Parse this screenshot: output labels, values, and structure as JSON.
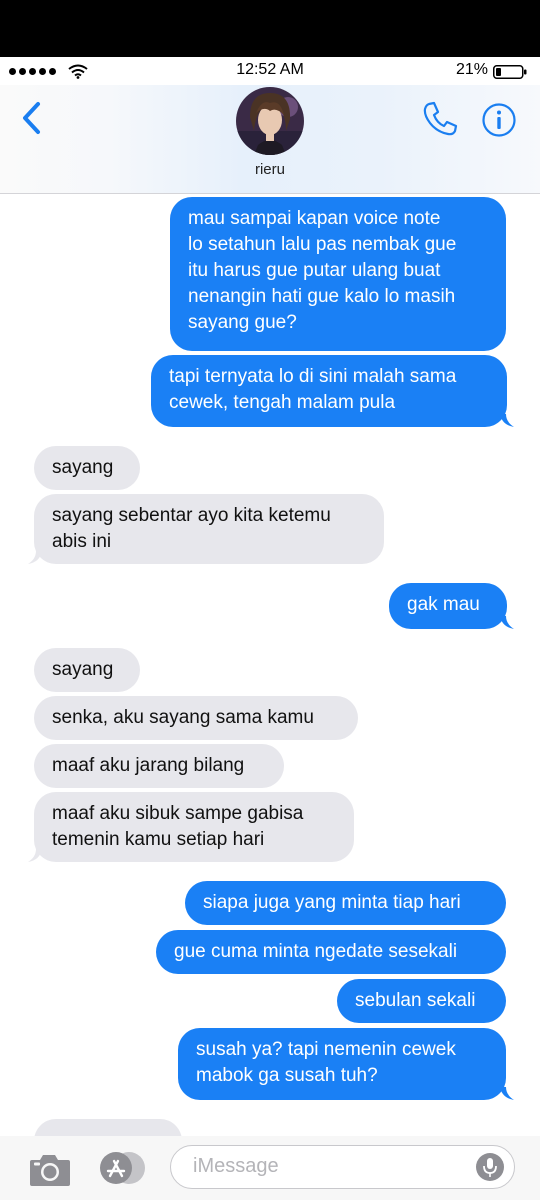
{
  "status_bar": {
    "time": "12:52 AM",
    "battery": "21%"
  },
  "header": {
    "contact_name": "rieru"
  },
  "messages": [
    {
      "from": "me",
      "lines": [
        "mau sampai kapan voice note",
        "lo setahun lalu pas nembak gue",
        "itu harus gue putar ulang buat",
        "nenangin hati gue kalo lo masih",
        "sayang gue?"
      ]
    },
    {
      "from": "me",
      "lines": [
        "tapi ternyata lo di sini malah sama",
        "cewek, tengah malam pula"
      ]
    },
    {
      "from": "them",
      "lines": [
        "sayang"
      ]
    },
    {
      "from": "them",
      "lines": [
        "sayang sebentar ayo kita ketemu",
        "abis ini"
      ]
    },
    {
      "from": "me",
      "lines": [
        "gak mau"
      ]
    },
    {
      "from": "them",
      "lines": [
        "sayang"
      ]
    },
    {
      "from": "them",
      "lines": [
        "senka, aku sayang sama kamu"
      ]
    },
    {
      "from": "them",
      "lines": [
        "maaf aku jarang bilang"
      ]
    },
    {
      "from": "them",
      "lines": [
        "maaf aku sibuk sampe gabisa",
        "temenin kamu setiap hari"
      ]
    },
    {
      "from": "me",
      "lines": [
        "siapa juga yang minta tiap hari"
      ]
    },
    {
      "from": "me",
      "lines": [
        "gue cuma minta ngedate sesekali"
      ]
    },
    {
      "from": "me",
      "lines": [
        "sebulan sekali"
      ]
    },
    {
      "from": "me",
      "lines": [
        "susah ya? tapi nemenin cewek",
        "mabok ga susah tuh?"
      ]
    }
  ],
  "composer": {
    "placeholder": "iMessage"
  },
  "icons": {
    "back": "chevron-left-icon",
    "phone": "phone-icon",
    "info": "info-icon",
    "camera": "camera-icon",
    "appstore": "app-store-icon",
    "mic": "microphone-icon"
  },
  "colors": {
    "sent_bubble": "#1a80f5",
    "received_bubble": "#e7e7ec",
    "accent": "#1a7ef0"
  }
}
